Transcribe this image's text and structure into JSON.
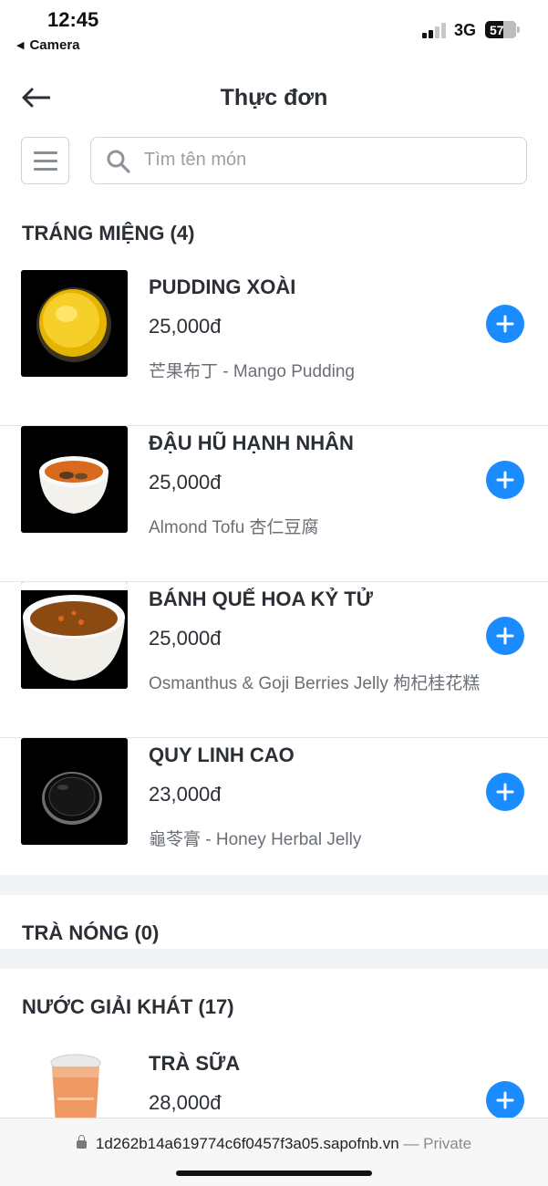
{
  "status_bar": {
    "time": "12:45",
    "back_app": "Camera",
    "network": "3G",
    "battery": "57"
  },
  "header": {
    "title": "Thực đơn"
  },
  "search": {
    "placeholder": "Tìm tên món",
    "value": ""
  },
  "sections": [
    {
      "title": "TRÁNG MIỆNG (4)",
      "items": [
        {
          "name": "PUDDING XOÀI",
          "price": "25,000đ",
          "description": "芒果布丁 - Mango Pudding"
        },
        {
          "name": "ĐẬU HŨ HẠNH NHÂN",
          "price": "25,000đ",
          "description": "Almond Tofu 杏仁豆腐"
        },
        {
          "name": "BÁNH QUẾ HOA KỶ TỬ",
          "price": "25,000đ",
          "description": "Osmanthus & Goji Berries Jelly 枸杞桂花糕"
        },
        {
          "name": "QUY LINH CAO",
          "price": "23,000đ",
          "description": "龜苓膏 - Honey Herbal Jelly"
        }
      ]
    },
    {
      "title": "TRÀ NÓNG (0)",
      "items": []
    },
    {
      "title": "NƯỚC GIẢI KHÁT (17)",
      "items": [
        {
          "name": "TRÀ SỮA",
          "price": "28,000đ",
          "description": ""
        }
      ]
    }
  ],
  "browser": {
    "url": "1d262b14a619774c6f0457f3a05.sapofnb.vn",
    "private_label": "— Private"
  },
  "icons": {
    "back": "back-arrow-icon",
    "menu": "hamburger-icon",
    "search": "search-icon",
    "add": "plus-icon",
    "lock": "lock-icon"
  },
  "colors": {
    "accent": "#1a8cff",
    "text": "#2b2f36",
    "muted": "#6a6f76",
    "band": "#f2f3f5"
  }
}
